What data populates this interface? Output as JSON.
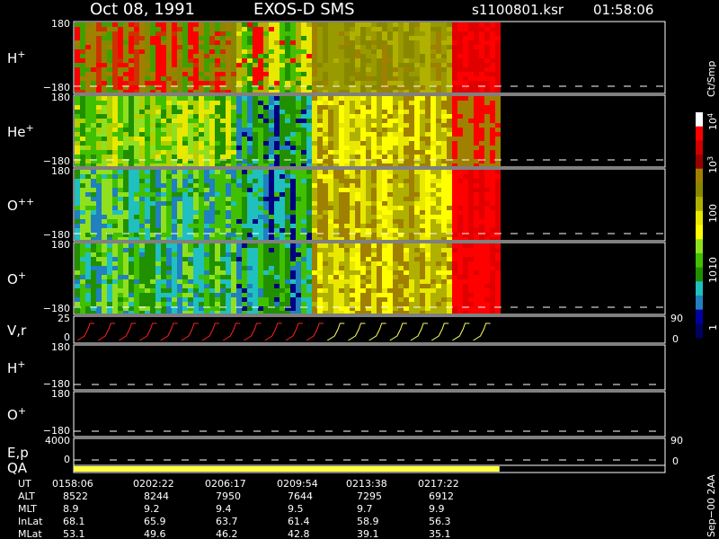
{
  "header": {
    "date": "Oct 08, 1991",
    "mission": "EXOS-D SMS",
    "file": "s1100801.ksr",
    "time": "01:58:06"
  },
  "chart_data": {
    "type": "heatmap",
    "panels": [
      {
        "id": "h-plus",
        "label": "H",
        "sup": "+",
        "ytop": "180",
        "ybot": "−180",
        "kind": "spectrogram",
        "right_top": "",
        "right_bot": ""
      },
      {
        "id": "he-plus",
        "label": "He",
        "sup": "+",
        "ytop": "180",
        "ybot": "−180",
        "kind": "spectrogram",
        "right_top": "",
        "right_bot": ""
      },
      {
        "id": "o-plusplus",
        "label": "O",
        "sup": "++",
        "ytop": "180",
        "ybot": "−180",
        "kind": "spectrogram",
        "right_top": "",
        "right_bot": ""
      },
      {
        "id": "o-plus",
        "label": "O",
        "sup": "+",
        "ytop": "180",
        "ybot": "−180",
        "kind": "spectrogram",
        "right_top": "",
        "right_bot": ""
      },
      {
        "id": "v-r",
        "label": "V,r",
        "sup": "",
        "ytop": "25",
        "ybot": "0",
        "kind": "sweep",
        "right_top": "90",
        "right_bot": "0"
      },
      {
        "id": "h-plus-2",
        "label": "H",
        "sup": "+",
        "ytop": "180",
        "ybot": "−180",
        "kind": "empty",
        "right_top": "",
        "right_bot": ""
      },
      {
        "id": "o-plus-2",
        "label": "O",
        "sup": "+",
        "ytop": "180",
        "ybot": "−180",
        "kind": "empty",
        "right_top": "",
        "right_bot": ""
      },
      {
        "id": "e-p",
        "label": "E,p",
        "sup": "",
        "ytop": "4000",
        "ybot": "0",
        "kind": "empty",
        "right_top": "90",
        "right_bot": "0"
      },
      {
        "id": "qa",
        "label": "QA",
        "sup": "",
        "ytop": "",
        "ybot": "",
        "kind": "qa",
        "right_top": "",
        "right_bot": ""
      }
    ],
    "colorbar": {
      "unit": "Ct/Smp",
      "tick_labels": [
        "10",
        "10",
        "100",
        "10",
        "10",
        "1"
      ],
      "tick_sup": [
        "4",
        "3",
        "",
        "",
        "",
        ""
      ],
      "tick_positions_value": [
        10000,
        1000,
        100,
        10,
        5,
        1
      ],
      "colors": [
        "#ffffff",
        "#ff0000",
        "#cc0000",
        "#990000",
        "#a08000",
        "#888800",
        "#b0b000",
        "#e8e800",
        "#ffff00",
        "#90e020",
        "#40c000",
        "#209000",
        "#20c0c0",
        "#2080c0",
        "#0000a0",
        "#000060"
      ]
    },
    "data_coverage_fraction": 0.72,
    "ephemeris": {
      "row_labels": [
        "UT",
        "ALT",
        "MLT",
        "InLat",
        "MLat"
      ],
      "columns": [
        {
          "UT": "0158:06",
          "ALT": "8522",
          "MLT": "8.9",
          "InLat": "68.1",
          "MLat": "53.1"
        },
        {
          "UT": "0202:22",
          "ALT": "8244",
          "MLT": "9.2",
          "InLat": "65.9",
          "MLat": "49.6"
        },
        {
          "UT": "0206:17",
          "ALT": "7950",
          "MLT": "9.4",
          "InLat": "63.7",
          "MLat": "46.2"
        },
        {
          "UT": "0209:54",
          "ALT": "7644",
          "MLT": "9.5",
          "InLat": "61.4",
          "MLat": "42.8"
        },
        {
          "UT": "0213:38",
          "ALT": "7295",
          "MLT": "9.7",
          "InLat": "58.9",
          "MLat": "39.1"
        },
        {
          "UT": "0217:22",
          "ALT": "6912",
          "MLT": "9.9",
          "InLat": "56.3",
          "MLat": "35.1"
        }
      ]
    },
    "footer_note": "Sep−00 2AA"
  }
}
